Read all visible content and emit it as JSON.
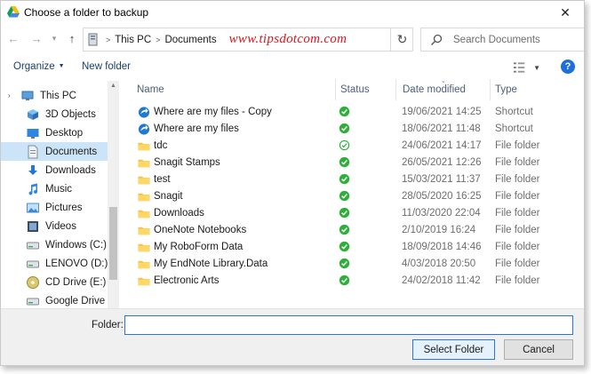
{
  "window": {
    "title": "Choose a folder to backup"
  },
  "address": {
    "crumbs": [
      "This PC",
      "Documents"
    ],
    "watermark": "www.tipsdotcom.com"
  },
  "search": {
    "placeholder": "Search Documents"
  },
  "toolbar": {
    "organize_label": "Organize",
    "new_folder_label": "New folder",
    "help_label": "?"
  },
  "nav": {
    "items": [
      {
        "label": "This PC",
        "icon": "pc-icon",
        "level": 0,
        "selected": false
      },
      {
        "label": "3D Objects",
        "icon": "3d-objects-icon",
        "level": 1,
        "selected": false
      },
      {
        "label": "Desktop",
        "icon": "desktop-icon",
        "level": 1,
        "selected": false
      },
      {
        "label": "Documents",
        "icon": "documents-icon",
        "level": 1,
        "selected": true
      },
      {
        "label": "Downloads",
        "icon": "downloads-icon",
        "level": 1,
        "selected": false
      },
      {
        "label": "Music",
        "icon": "music-icon",
        "level": 1,
        "selected": false
      },
      {
        "label": "Pictures",
        "icon": "pictures-icon",
        "level": 1,
        "selected": false
      },
      {
        "label": "Videos",
        "icon": "videos-icon",
        "level": 1,
        "selected": false
      },
      {
        "label": "Windows (C:)",
        "icon": "drive-icon",
        "level": 1,
        "selected": false
      },
      {
        "label": "LENOVO (D:)",
        "icon": "drive-icon",
        "level": 1,
        "selected": false
      },
      {
        "label": "CD Drive (E:)",
        "icon": "cd-drive-icon",
        "level": 1,
        "selected": false
      },
      {
        "label": "Google Drive (G:",
        "icon": "drive-icon",
        "level": 1,
        "selected": false
      }
    ]
  },
  "columns": {
    "name": "Name",
    "status": "Status",
    "date": "Date modified",
    "type": "Type"
  },
  "files": [
    {
      "name": "Where are my files - Copy",
      "icon": "shortcut-icon",
      "status": "synced",
      "date": "19/06/2021 14:25",
      "type": "Shortcut"
    },
    {
      "name": "Where are my files",
      "icon": "shortcut-icon",
      "status": "synced",
      "date": "18/06/2021 11:48",
      "type": "Shortcut"
    },
    {
      "name": "tdc",
      "icon": "folder-icon",
      "status": "available",
      "date": "24/06/2021 14:17",
      "type": "File folder"
    },
    {
      "name": "Snagit Stamps",
      "icon": "folder-icon",
      "status": "synced",
      "date": "26/05/2021 12:26",
      "type": "File folder"
    },
    {
      "name": "test",
      "icon": "folder-icon",
      "status": "synced",
      "date": "15/03/2021 11:37",
      "type": "File folder"
    },
    {
      "name": "Snagit",
      "icon": "folder-icon",
      "status": "synced",
      "date": "28/05/2020 16:25",
      "type": "File folder"
    },
    {
      "name": "Downloads",
      "icon": "folder-icon",
      "status": "synced",
      "date": "11/03/2020 22:04",
      "type": "File folder"
    },
    {
      "name": "OneNote Notebooks",
      "icon": "folder-icon",
      "status": "synced",
      "date": "2/10/2019 16:24",
      "type": "File folder"
    },
    {
      "name": "My RoboForm Data",
      "icon": "folder-icon",
      "status": "synced",
      "date": "18/09/2018 14:46",
      "type": "File folder"
    },
    {
      "name": "My EndNote Library.Data",
      "icon": "folder-icon",
      "status": "synced",
      "date": "4/03/2018 20:50",
      "type": "File folder"
    },
    {
      "name": "Electronic Arts",
      "icon": "folder-icon",
      "status": "synced",
      "date": "24/02/2018 11:42",
      "type": "File folder"
    }
  ],
  "footer": {
    "folder_label": "Folder:",
    "folder_value": "",
    "select_label": "Select Folder",
    "cancel_label": "Cancel"
  },
  "colors": {
    "accent": "#2a76d2",
    "selected_bg": "#cce4f7",
    "status_green": "#2fae3a",
    "folder_yellow": "#f5c342",
    "watermark_red": "#e0141e"
  }
}
